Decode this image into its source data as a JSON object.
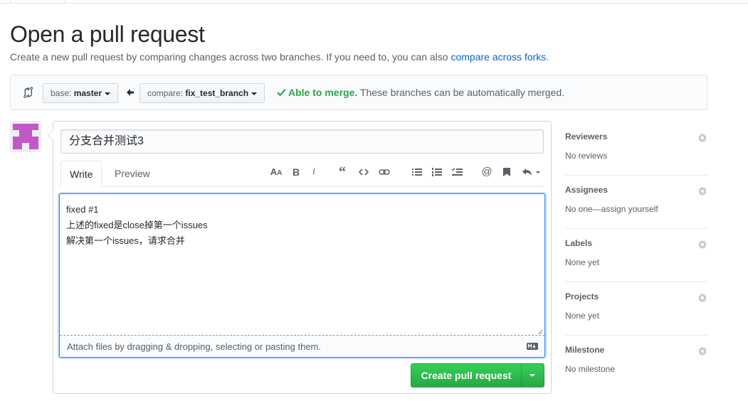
{
  "page": {
    "title": "Open a pull request",
    "description_prefix": "Create a new pull request by comparing changes across two branches. If you need to, you can also ",
    "description_link": "compare across forks",
    "description_suffix": "."
  },
  "range": {
    "base_prefix": "base: ",
    "base_value": "master",
    "compare_prefix": "compare: ",
    "compare_value": "fix_test_branch",
    "merge_ok": "Able to merge.",
    "merge_msg": " These branches can be automatically merged."
  },
  "form": {
    "title_value": "分支合并测试3",
    "tabs": [
      "Write",
      "Preview"
    ],
    "toolbar_icons": [
      "header-icon",
      "bold-icon",
      "italic-icon",
      "quote-icon",
      "code-icon",
      "link-icon",
      "unordered-list-icon",
      "ordered-list-icon",
      "task-list-icon",
      "mention-icon",
      "saved-reply-icon",
      "reply-icon"
    ],
    "body_text": "fixed #1\n上述的fixed是close掉第一个issues\n解决第一个issues，请求合并",
    "attach_text": "Attach files by dragging & dropping, selecting or pasting them.",
    "submit_label": "Create pull request"
  },
  "sidebar": {
    "sections": [
      {
        "title": "Reviewers",
        "value": "No reviews"
      },
      {
        "title": "Assignees",
        "value": "No one—assign yourself"
      },
      {
        "title": "Labels",
        "value": "None yet"
      },
      {
        "title": "Projects",
        "value": "None yet"
      },
      {
        "title": "Milestone",
        "value": "No milestone"
      }
    ]
  },
  "colors": {
    "accent": "#0366d6",
    "success": "#28a745",
    "avatar": "#c258c8"
  }
}
